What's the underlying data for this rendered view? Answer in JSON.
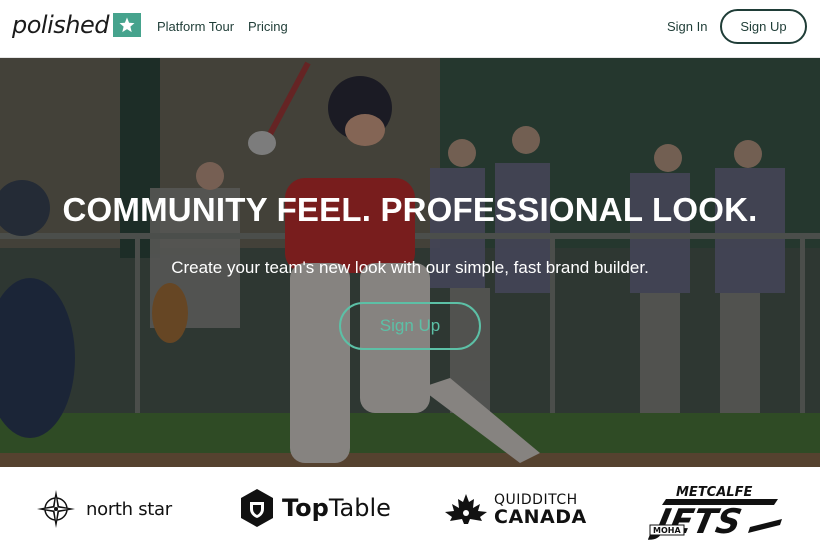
{
  "header": {
    "logo_text": "polished",
    "nav": [
      "Platform Tour",
      "Pricing"
    ],
    "sign_in": "Sign In",
    "sign_up": "Sign Up"
  },
  "hero": {
    "title": "COMMUNITY FEEL. PROFESSIONAL LOOK.",
    "subtitle": "Create your team's new look with our simple, fast brand builder.",
    "cta": "Sign Up"
  },
  "partners": {
    "north_star": "north star",
    "toptable_bold": "Top",
    "toptable_reg": "Table",
    "quidditch_line1": "QUIDDITCH",
    "quidditch_line2": "CANADA",
    "jets_top": "METCALFE",
    "jets_main": "JETS",
    "jets_small": "MOHA"
  },
  "colors": {
    "brand_green": "#46a38d",
    "cta_green": "#5cc0a6",
    "text_dark": "#1f3d37"
  }
}
